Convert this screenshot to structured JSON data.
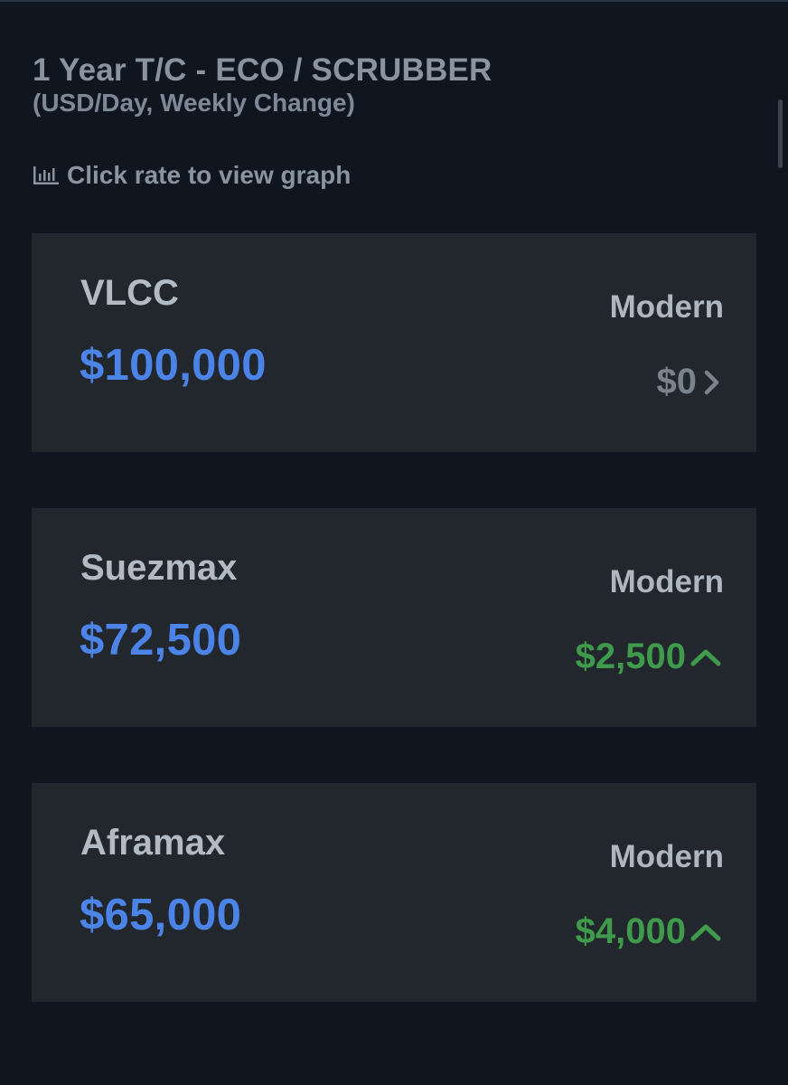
{
  "header": {
    "title": "1 Year T/C - ECO / SCRUBBER",
    "subtitle": "(USD/Day, Weekly Change)",
    "hint": "Click rate to view graph",
    "hint_icon": "bar-chart-icon"
  },
  "cards": [
    {
      "name": "VLCC",
      "rate": "$100,000",
      "class": "Modern",
      "change": "$0",
      "change_direction": "neutral",
      "change_icon": "chevron-right-icon"
    },
    {
      "name": "Suezmax",
      "rate": "$72,500",
      "class": "Modern",
      "change": "$2,500",
      "change_direction": "up",
      "change_icon": "chevron-up-icon"
    },
    {
      "name": "Aframax",
      "rate": "$65,000",
      "class": "Modern",
      "change": "$4,000",
      "change_direction": "up",
      "change_icon": "chevron-up-icon"
    }
  ],
  "colors": {
    "background": "#0f1620",
    "card": "#22272d",
    "rate": "#4b84e6",
    "up": "#3f9a4c",
    "neutral": "#7a828c"
  }
}
